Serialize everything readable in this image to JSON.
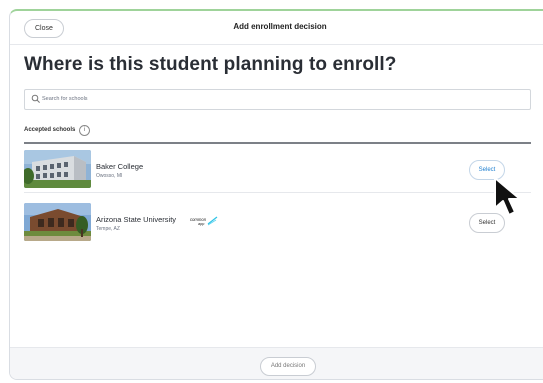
{
  "header": {
    "close_label": "Close",
    "title": "Add enrollment decision"
  },
  "page_title": "Where is this student planning to enroll?",
  "search": {
    "placeholder": "Search for schools",
    "value": ""
  },
  "section": {
    "label": "Accepted schools",
    "info_icon": "i"
  },
  "schools": [
    {
      "name": "Baker College",
      "location": "Owosso, MI",
      "button_label": "Select"
    },
    {
      "name": "Arizona State University",
      "location": "Tempe, AZ",
      "badge": "common app",
      "button_label": "Select"
    }
  ],
  "footer": {
    "add_label": "Add decision"
  },
  "colors": {
    "accent": "#1e7fd0",
    "top_border": "#9fd39a",
    "footer_bg": "#f5f6f8"
  }
}
